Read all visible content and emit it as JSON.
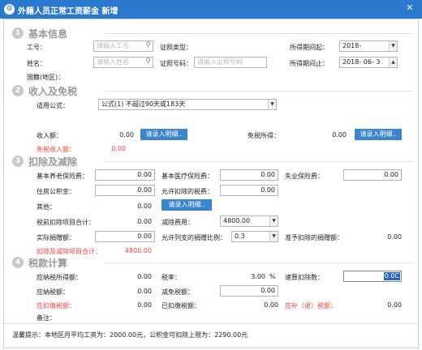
{
  "window": {
    "title": "外籍人员正常工资薪金 新增",
    "close_glyph": "✕"
  },
  "sections": {
    "basic": {
      "num": "1",
      "title": "基本信息"
    },
    "income": {
      "num": "2",
      "title": "收入及免税"
    },
    "deduct": {
      "num": "3",
      "title": "扣除及减除"
    },
    "tax": {
      "num": "4",
      "title": "税款计算"
    }
  },
  "basic": {
    "emp_id_label": "工号：",
    "emp_id_placeholder": "请输入工号",
    "id_type_label": "证照类型：",
    "period_start_label": "所得期间起：",
    "period_start_value": "2018-",
    "name_label": "姓名：",
    "name_placeholder": "请输入姓名",
    "id_no_label": "证照号码：",
    "id_no_placeholder": "请输入证照号码",
    "period_end_label": "所得期间止：",
    "period_end_value": "2018-  06-  3",
    "nationality_label": "国籍(地区)："
  },
  "income": {
    "formula_label": "适用公式：",
    "formula_value": "公式(1) 不超过90天或183天",
    "income_label": "收入额：",
    "income_value": "0.00",
    "income_btn": "请录入明细..",
    "exempt_label": "免税所得：",
    "exempt_value": "0.00",
    "exempt_btn": "请录入明细..",
    "taxable_label": "免税收入额：",
    "taxable_value": "0.00"
  },
  "deduct": {
    "pension_label": "基本养老保险费：",
    "pension_value": "0.00",
    "medical_label": "基本医疗保险费：",
    "medical_value": "0.00",
    "unemployment_label": "失业保险费：",
    "unemployment_value": "0.00",
    "housing_label": "住房公积金：",
    "housing_value": "0.00",
    "allowed_tax_label": "允许扣除的税费：",
    "allowed_tax_value": "0.00",
    "other_label": "其他：",
    "other_value": "0.00",
    "other_btn": "请录入明细..",
    "pretax_total_label": "税前扣除项目合计：",
    "pretax_total_value": "0.00",
    "reduction_label": "减除费用：",
    "reduction_value": "4800.00",
    "donation_label": "实际捐赠额：",
    "donation_value": "0.00",
    "donation_ratio_label": "允许列支的捐赠比例：",
    "donation_ratio_value": "0.3",
    "allowed_donation_label": "准予扣除的捐赠额：",
    "allowed_donation_value": "0.00",
    "total_label": "扣除及减除项目合计：",
    "total_value": "4800.00"
  },
  "tax": {
    "taxable_income_label": "应纳税所得额：",
    "taxable_income_value": "0.00",
    "rate_label": "税率：",
    "rate_value": "3.00",
    "rate_unit": "%",
    "quick_deduct_label": "速算扣除数：",
    "quick_deduct_value": "0.0C",
    "payable_label": "应纳税额：",
    "payable_value": "0.00",
    "relief_label": "减免税额：",
    "relief_value": "0.00",
    "due_label": "应扣缴税额：",
    "due_value": "0.00",
    "withheld_label": "已扣缴税额：",
    "withheld_value": "0.00",
    "refund_label": "应补（退）税额：",
    "refund_value": "0.00",
    "remark_label": "备注："
  },
  "footer": {
    "hint": "温馨提示：本地区月平均工资为：2000.00元，公积金可扣除上限为：2290.00元"
  },
  "colors": {
    "titlebar": "#2b79cf",
    "button": "#3a85d0",
    "red_text": "#e44",
    "highlight": "#2b65c2"
  },
  "icons": [
    "gear-icon",
    "close-icon",
    "search-icon",
    "dropdown-arrow-icon",
    "spin-arrow-icon"
  ]
}
